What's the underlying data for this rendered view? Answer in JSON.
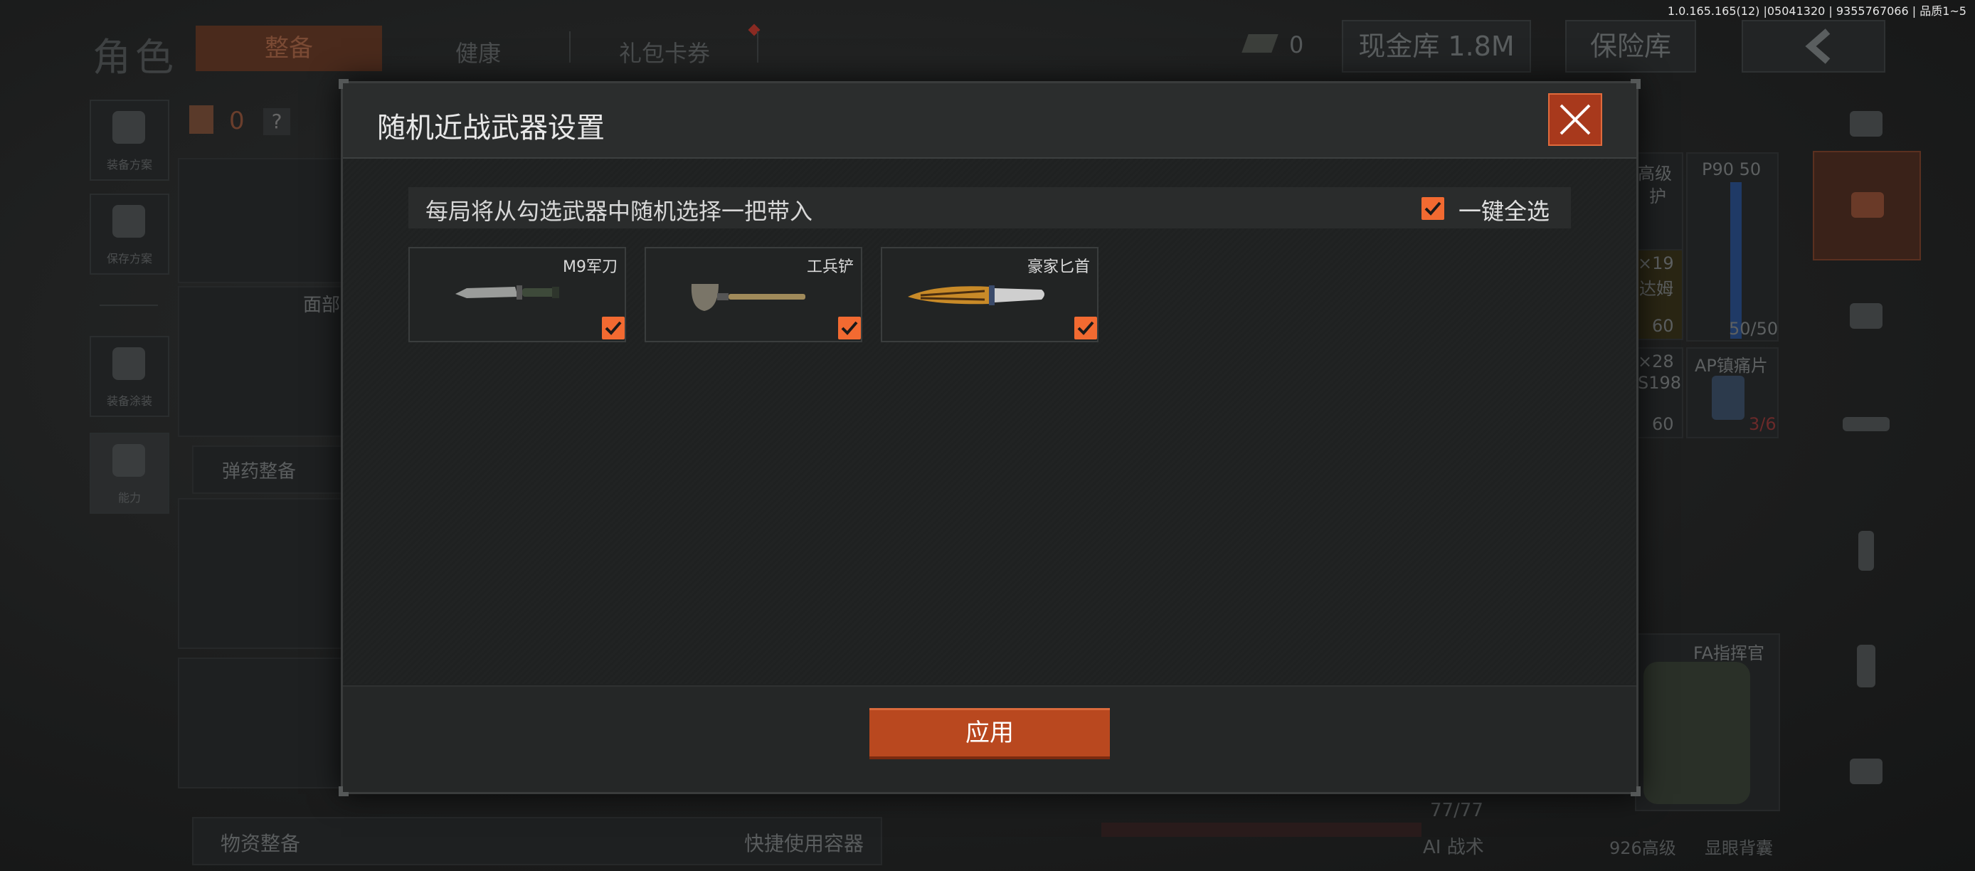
{
  "version_text": "1.0.165.165(12) |05041320 | 9355767066 | 品质1~5",
  "background": {
    "page_title": "角色",
    "tabs": [
      "整备",
      "健康",
      "礼包卡券"
    ],
    "currency_value": "0",
    "cash_vault_label": "现金库 1.8M",
    "safe_label": "保险库",
    "left_sidebar": [
      "装备方案",
      "保存方案",
      "装备涂装",
      "能力"
    ],
    "backpack_count": "0",
    "help_label": "?",
    "face_label": "面部",
    "ammo_label": "弹药整备",
    "supply_label": "物资整备",
    "quick_container_label": "快捷使用容器",
    "durability_label": "77/77",
    "ai_label": "AI 战术",
    "right_items": {
      "p90_label": "P90 50",
      "p90_count": "50/50",
      "item_a_title": "高级",
      "item_a_sub": "护",
      "item_b_title": "×19",
      "item_b_sub": "达姆",
      "item_b_count": "60",
      "item_c_title": "×28",
      "item_c_sub": "S198",
      "item_c_count": "60",
      "item_d_title": "AP镇痛片",
      "item_d_count": "3/6",
      "fa_label": "FA指挥官",
      "bottom_a": "926高级",
      "bottom_b": "显眼背囊"
    }
  },
  "modal": {
    "title": "随机近战武器设置",
    "subtitle": "每局将从勾选武器中随机选择一把带入",
    "select_all_label": "一键全选",
    "select_all_checked": true,
    "weapons": [
      {
        "name": "M9军刀",
        "checked": true,
        "icon": "knife-icon"
      },
      {
        "name": "工兵铲",
        "checked": true,
        "icon": "shovel-icon"
      },
      {
        "name": "豪家匕首",
        "checked": true,
        "icon": "dagger-icon"
      }
    ],
    "apply_label": "应用"
  },
  "colors": {
    "accent": "#f26a31",
    "close_bg": "#a8391c",
    "apply_bg": "#b9481f"
  }
}
